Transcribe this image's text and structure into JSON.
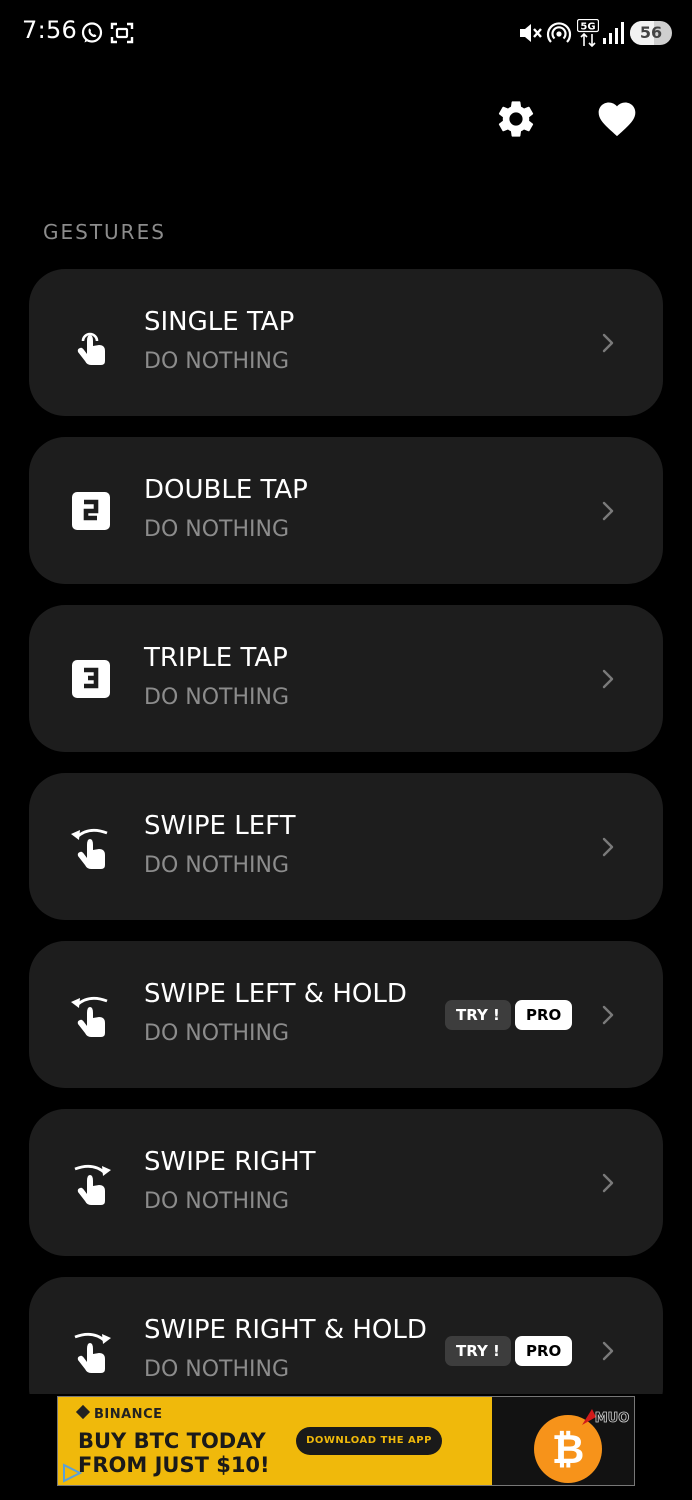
{
  "status_bar": {
    "time": "7:56",
    "network": "5G",
    "battery": "56",
    "battery_level": 0.56,
    "icons": [
      "whatsapp-icon",
      "screenshot-icon",
      "mute-icon",
      "hotspot-icon",
      "5g-icon",
      "signal-icon"
    ]
  },
  "app_bar": {
    "icons": [
      "gear-icon",
      "heart-icon"
    ]
  },
  "section_label": "GESTURES",
  "gestures": [
    {
      "title": "SINGLE TAP",
      "subtitle": "DO NOTHING",
      "icon": "single-tap-icon"
    },
    {
      "title": "DOUBLE TAP",
      "subtitle": "DO NOTHING",
      "icon": "number-2-icon"
    },
    {
      "title": "TRIPLE TAP",
      "subtitle": "DO NOTHING",
      "icon": "number-3-icon"
    },
    {
      "title": "SWIPE LEFT",
      "subtitle": "DO NOTHING",
      "icon": "swipe-left-icon"
    },
    {
      "title": "SWIPE LEFT & HOLD",
      "subtitle": "DO NOTHING",
      "icon": "swipe-left-hold-icon",
      "try": "TRY !",
      "pro": "PRO"
    },
    {
      "title": "SWIPE RIGHT",
      "subtitle": "DO NOTHING",
      "icon": "swipe-right-icon"
    },
    {
      "title": "SWIPE RIGHT & HOLD",
      "subtitle": "DO NOTHING",
      "icon": "swipe-right-hold-icon",
      "try": "TRY !",
      "pro": "PRO"
    }
  ],
  "ad": {
    "brand": "BINANCE",
    "headline_1": "BUY BTC TODAY",
    "headline_2": "FROM JUST $10!",
    "cta": "DOWNLOAD THE APP",
    "logo_text": "MUO",
    "colors": {
      "background": "#f0b90b",
      "coin": "#f7931a",
      "text": "#1a1a1a"
    }
  },
  "colors": {
    "background": "#000000",
    "card": "#1d1d1d",
    "title": "#ffffff",
    "subtitle": "#8c8c8c",
    "section_label": "#8c8c8c",
    "try_badge": "#3d3d3d",
    "pro_badge": "#ffffff"
  }
}
